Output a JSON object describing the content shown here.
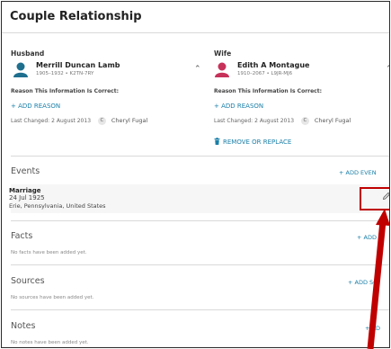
{
  "title": "Couple Relationship",
  "husband": {
    "heading": "Husband",
    "name": "Merrill Duncan Lamb",
    "dates": "1905–1932 • K2TN-7RY",
    "avatar_icon": "male-avatar-icon",
    "reason_label": "Reason This Information Is Correct:",
    "add_reason": "+ ADD REASON",
    "last_changed": "Last Changed: 2 August 2013",
    "user_initial": "C",
    "user": "Cheryl Fugal"
  },
  "wife": {
    "heading": "Wife",
    "name": "Edith A Montague",
    "dates": "1910–2067 • L9JR-MJ6",
    "avatar_icon": "female-avatar-icon",
    "reason_label": "Reason This Information Is Correct:",
    "add_reason": "+ ADD REASON",
    "last_changed": "Last Changed: 2 August 2013",
    "user_initial": "C",
    "user": "Cheryl Fugal",
    "remove": "REMOVE OR REPLACE"
  },
  "events": {
    "heading": "Events",
    "add": "+ ADD EVEN",
    "item": {
      "type": "Marriage",
      "date": "24 Jul 1925",
      "place": "Erie, Pennsylvania, United States"
    }
  },
  "facts": {
    "heading": "Facts",
    "add": "+ ADD",
    "empty": "No facts have been added yet."
  },
  "sources": {
    "heading": "Sources",
    "add": "+ ADD SO",
    "empty": "No sources have been added yet."
  },
  "notes": {
    "heading": "Notes",
    "add": "+ AD",
    "empty": "No notes have been added yet."
  },
  "colors": {
    "link": "#1a7fa8",
    "highlight": "#c00000",
    "male_avatar": "#1f6f8f",
    "female_avatar": "#c7325a"
  }
}
